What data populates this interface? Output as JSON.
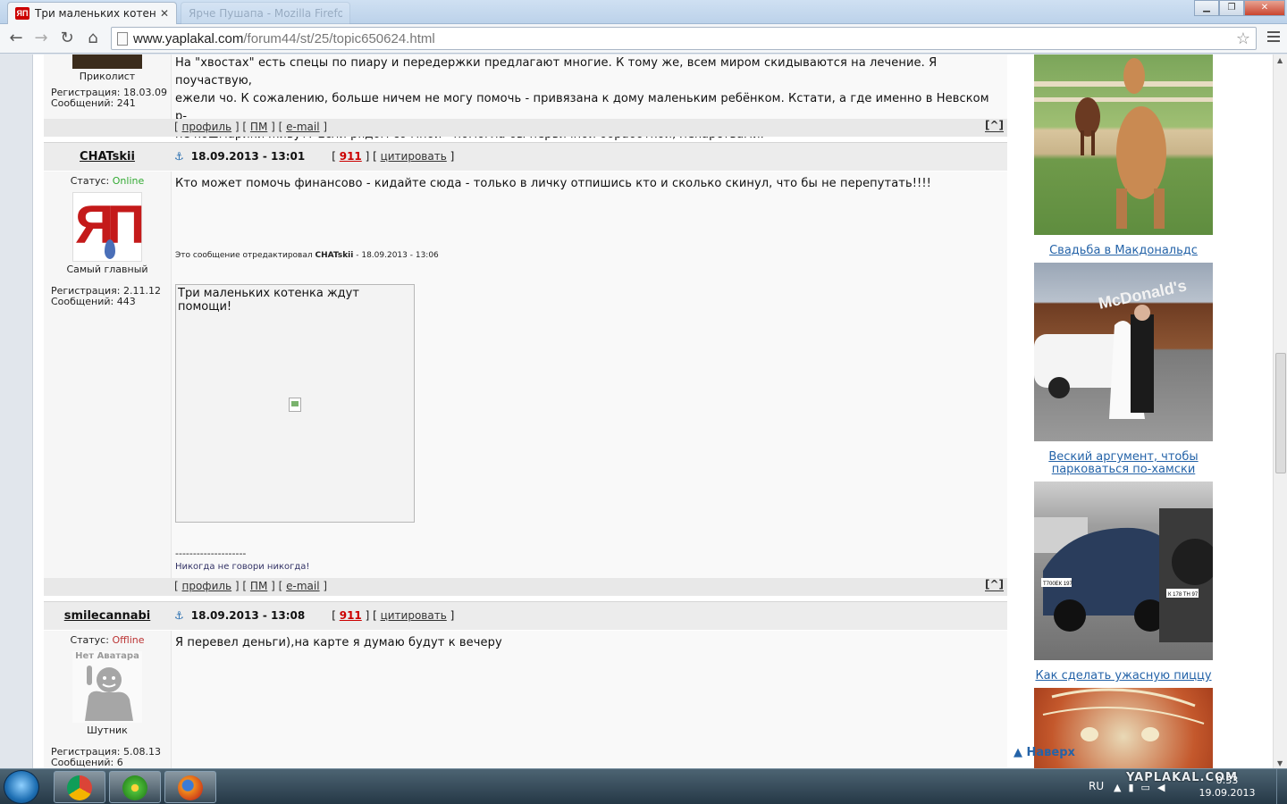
{
  "browser": {
    "active_tab_title": "Три маленьких котенка ж",
    "active_tab_favicon": "ЯП",
    "ghost_tab_title": "Ярче Пушапа - Mozilla Firefox",
    "url_host": "www.yaplakal.com",
    "url_path": "/forum44/st/25/topic650624.html",
    "window_controls": [
      "minimize-icon",
      "maximize-icon",
      "close-icon"
    ]
  },
  "posts": [
    {
      "id": "prev",
      "rank": "Приколист",
      "registration": "Регистрация: 18.03.09",
      "messages": "Сообщений: 241",
      "lines": [
        "На \"хвостах\" есть спецы по пиару и передержки предлагают многие. К тому же, всем миром скидываются на лечение. Я поучаствую,",
        "ежели чо. К сожалению, больше ничем не могу помочь - привязана к дому маленьким ребёнком. Кстати, а где именно в Невском р-",
        "не кошмарики живут? Если рядом со мной - помогла бы первичной обработкой, лекарствами."
      ]
    },
    {
      "id": "chatskii",
      "username": "CHATskii",
      "date": "18.09.2013 - 13:01",
      "num": "911",
      "quote": "цитировать",
      "status_label": "Статус:",
      "status_value": "Online",
      "avatar_letters": "ЯП",
      "rank": "Самый главный",
      "registration": "Регистрация: 2.11.12",
      "messages": "Сообщений: 443",
      "text": "Кто может помочь финансово - кидайте сюда - только в личку отпишись кто и сколько скинул, что бы не перепутать!!!!",
      "edited_prefix": "Это сообщение отредактировал",
      "edited_user": "CHATskii",
      "edited_suffix": "- 18.09.2013 - 13:06",
      "image_caption": "Три маленьких котенка ждут помощи!",
      "signature_line": "--------------------",
      "signature": "Никогда не говори никогда!"
    },
    {
      "id": "smilecannabi",
      "username": "smilecannabi",
      "date": "18.09.2013 - 13:08",
      "num": "911",
      "quote": "цитировать",
      "status_label": "Статус:",
      "status_value": "Offline",
      "no_avatar": "Нет Аватара",
      "rank": "Шутник",
      "registration": "Регистрация: 5.08.13",
      "messages": "Сообщений: 6",
      "text": "Я перевел деньги),на карте я думаю будут к вечеру"
    }
  ],
  "post_links": {
    "profile": "профиль",
    "pm": "ПМ",
    "email": "e-mail",
    "to_top": "[^]"
  },
  "sidebar": {
    "captions": [
      "Свадьба в Макдональдс",
      "Веский аргумент, чтобы",
      "парковаться по-хамски",
      "Как сделать ужасную пиццу"
    ],
    "mcdonalds_sign": "McDonald's",
    "plate_1": "Т700ЕК 197",
    "plate_2": "К 178 ТН 97"
  },
  "back_to_top": "Наверх",
  "taskbar": {
    "lang": "RU",
    "time": "0:33",
    "date": "19.09.2013",
    "logo": "YAPLAKAL.COM",
    "apps": [
      "chrome-icon",
      "icq-icon",
      "firefox-icon"
    ]
  },
  "colors": {
    "accent_link": "#2463a8",
    "online": "#33aa33",
    "offline": "#bb3333",
    "brand_red": "#c41a1a"
  }
}
